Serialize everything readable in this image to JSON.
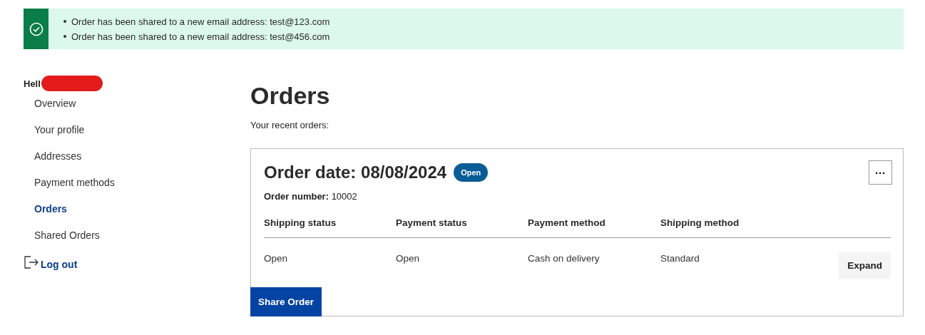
{
  "alert": {
    "messages": [
      "Order has been shared to a new email address: test@123.com",
      "Order has been shared to a new email address: test@456.com"
    ]
  },
  "sidebar": {
    "greeting": "Hell",
    "redacted": true,
    "items": [
      {
        "label": "Overview",
        "selected": false
      },
      {
        "label": "Your profile",
        "selected": false
      },
      {
        "label": "Addresses",
        "selected": false
      },
      {
        "label": "Payment methods",
        "selected": false
      },
      {
        "label": "Orders",
        "selected": true
      },
      {
        "label": "Shared Orders",
        "selected": false
      }
    ],
    "logout": "Log out"
  },
  "main": {
    "title": "Orders",
    "subtitle": "Your recent orders:"
  },
  "order": {
    "date_title": "Order date: 08/08/2024",
    "status_badge": "Open",
    "menu_button": "···",
    "number": "**Order number:** 10002",
    "table": {
      "columns": [
        "Shipping status",
        "Payment status",
        "Payment method",
        "Shipping method"
      ],
      "row": [
        "Open",
        "Open",
        "Cash on delivery",
        "Standard"
      ]
    },
    "expand_button": "Expand",
    "share_button": "Share Order"
  }
}
